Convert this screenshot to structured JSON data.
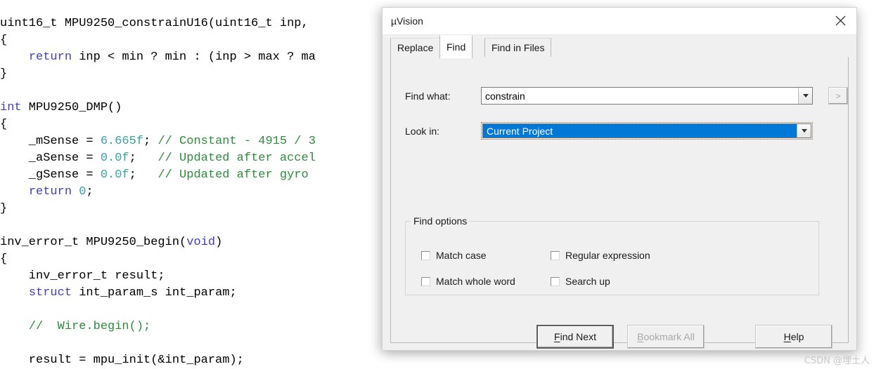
{
  "editor": {
    "lines": [
      [
        {
          "t": "uint16_t MPU9250_constrainU16(uint16_t inp, ",
          "c": "plain"
        }
      ],
      [
        {
          "t": "{",
          "c": "plain"
        }
      ],
      [
        {
          "t": "    ",
          "c": "plain"
        },
        {
          "t": "return",
          "c": "kw"
        },
        {
          "t": " inp < min ? min : (inp > max ? ma",
          "c": "plain"
        }
      ],
      [
        {
          "t": "}",
          "c": "plain"
        }
      ],
      [
        {
          "t": "",
          "c": "plain"
        }
      ],
      [
        {
          "t": "int",
          "c": "kw"
        },
        {
          "t": " MPU9250_DMP()",
          "c": "plain"
        }
      ],
      [
        {
          "t": "{",
          "c": "plain"
        }
      ],
      [
        {
          "t": "    _mSense = ",
          "c": "plain"
        },
        {
          "t": "6.665f",
          "c": "num"
        },
        {
          "t": "; ",
          "c": "plain"
        },
        {
          "t": "// Constant - 4915 / 3",
          "c": "cm"
        }
      ],
      [
        {
          "t": "    _aSense = ",
          "c": "plain"
        },
        {
          "t": "0.0f",
          "c": "num"
        },
        {
          "t": ";   ",
          "c": "plain"
        },
        {
          "t": "// Updated after accel",
          "c": "cm"
        }
      ],
      [
        {
          "t": "    _gSense = ",
          "c": "plain"
        },
        {
          "t": "0.0f",
          "c": "num"
        },
        {
          "t": ";   ",
          "c": "plain"
        },
        {
          "t": "// Updated after gyro ",
          "c": "cm"
        }
      ],
      [
        {
          "t": "    ",
          "c": "plain"
        },
        {
          "t": "return",
          "c": "kw"
        },
        {
          "t": " ",
          "c": "plain"
        },
        {
          "t": "0",
          "c": "num"
        },
        {
          "t": ";",
          "c": "plain"
        }
      ],
      [
        {
          "t": "}",
          "c": "plain"
        }
      ],
      [
        {
          "t": "",
          "c": "plain"
        }
      ],
      [
        {
          "t": "inv_error_t MPU9250_begin(",
          "c": "plain"
        },
        {
          "t": "void",
          "c": "kw"
        },
        {
          "t": ")",
          "c": "plain"
        }
      ],
      [
        {
          "t": "{",
          "c": "plain"
        }
      ],
      [
        {
          "t": "    inv_error_t result;",
          "c": "plain"
        }
      ],
      [
        {
          "t": "    ",
          "c": "plain"
        },
        {
          "t": "struct",
          "c": "kw"
        },
        {
          "t": " int_param_s int_param;",
          "c": "plain"
        }
      ],
      [
        {
          "t": "",
          "c": "plain"
        }
      ],
      [
        {
          "t": "    ",
          "c": "plain"
        },
        {
          "t": "//  Wire.begin();",
          "c": "cm"
        }
      ],
      [
        {
          "t": "",
          "c": "plain"
        }
      ],
      [
        {
          "t": "    result = mpu_init(&int_param);",
          "c": "plain"
        }
      ]
    ],
    "colors": {
      "keyword": "#3f3fbf",
      "comment": "#2e8b3c",
      "number": "#3aa3a3",
      "plain": "#000000"
    }
  },
  "dialog": {
    "title": "µVision",
    "close_icon": "close-icon",
    "tabs": [
      {
        "id": "replace",
        "label": "Replace",
        "active": false
      },
      {
        "id": "find",
        "label": "Find",
        "active": true
      },
      {
        "id": "findinfiles",
        "label": "Find in Files",
        "active": false
      }
    ],
    "fields": {
      "find_what_label": "Find what:",
      "find_what_value": "constrain",
      "find_what_placeholder": "",
      "look_in_label": "Look in:",
      "look_in_value": "Current Project",
      "more_button_label": ">"
    },
    "find_options": {
      "title": "Find options",
      "checkboxes": [
        {
          "id": "match-case",
          "label": "Match case",
          "checked": false
        },
        {
          "id": "match-whole-word",
          "label": "Match whole word",
          "checked": false
        },
        {
          "id": "regular-expression",
          "label": "Regular expression",
          "checked": false
        },
        {
          "id": "search-up",
          "label": "Search up",
          "checked": false
        }
      ]
    },
    "buttons": {
      "find_next": "Find Next",
      "find_next_mnemonic": "F",
      "bookmark_all": "Bookmark All",
      "bookmark_all_mnemonic": "B",
      "bookmark_all_enabled": false,
      "help": "Help",
      "help_mnemonic": "H"
    },
    "accent_color": "#0078d7"
  },
  "watermark": {
    "text": "CSDN @埋土人"
  }
}
